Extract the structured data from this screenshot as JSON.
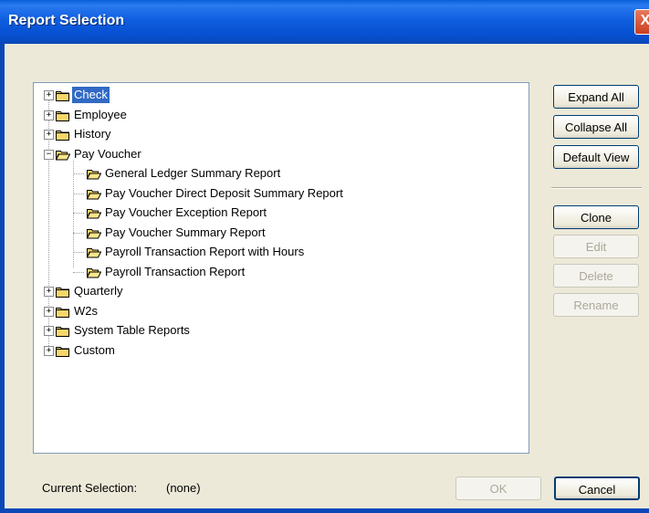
{
  "window": {
    "title": "Report Selection",
    "close_label": "X"
  },
  "tree": {
    "items": [
      {
        "label": "Check",
        "expanded": false,
        "selected": true
      },
      {
        "label": "Employee",
        "expanded": false
      },
      {
        "label": "History",
        "expanded": false
      },
      {
        "label": "Pay Voucher",
        "expanded": true,
        "children": [
          "General Ledger Summary Report",
          "Pay Voucher Direct Deposit Summary Report",
          "Pay Voucher Exception Report",
          "Pay Voucher Summary Report",
          "Payroll Transaction Report with Hours",
          "Payroll Transaction Report"
        ]
      },
      {
        "label": "Quarterly",
        "expanded": false
      },
      {
        "label": "W2s",
        "expanded": false
      },
      {
        "label": "System Table Reports",
        "expanded": false
      },
      {
        "label": "Custom",
        "expanded": false
      }
    ]
  },
  "buttons": {
    "expand_all": "Expand All",
    "collapse_all": "Collapse All",
    "default_view": "Default View",
    "clone": "Clone",
    "edit": "Edit",
    "delete": "Delete",
    "rename": "Rename",
    "ok": "OK",
    "cancel": "Cancel"
  },
  "status": {
    "label": "Current Selection:",
    "value": "(none)"
  },
  "colors": {
    "titlebar": "#0a5fd8",
    "selection": "#316ac5",
    "folder": "#f7d66b"
  }
}
